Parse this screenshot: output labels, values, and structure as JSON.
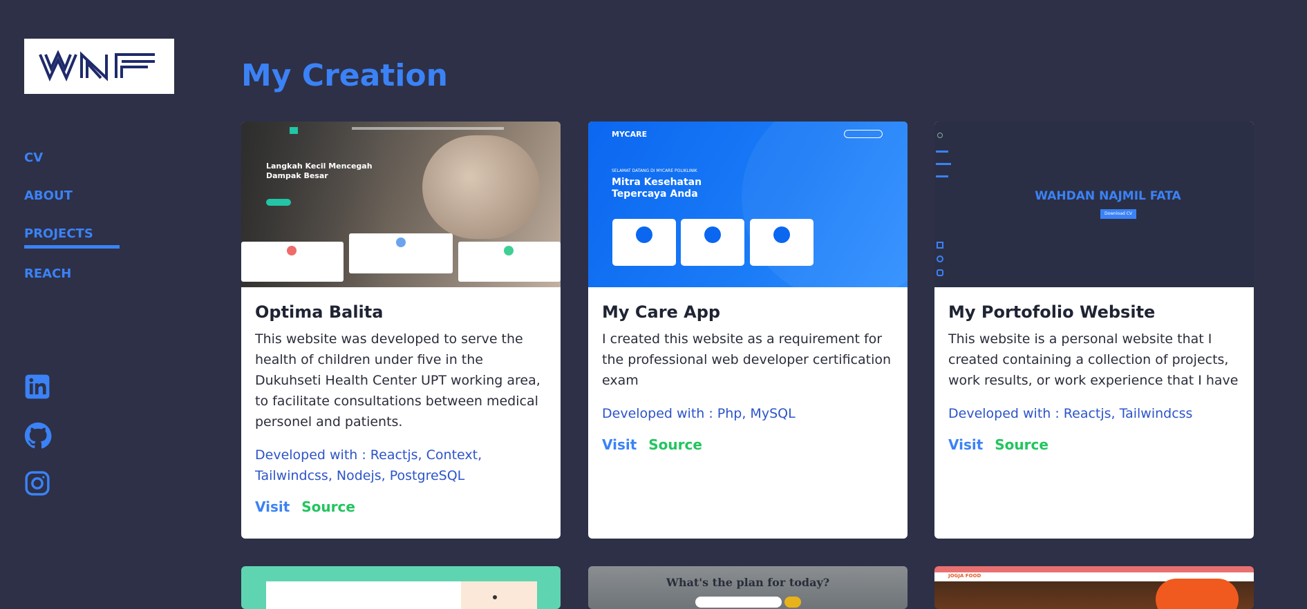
{
  "logo": {
    "text": "WNF"
  },
  "nav": {
    "items": [
      {
        "label": "CV"
      },
      {
        "label": "ABOUT"
      },
      {
        "label": "PROJECTS",
        "active": true
      },
      {
        "label": "REACH"
      }
    ]
  },
  "social": [
    {
      "icon": "linkedin-icon"
    },
    {
      "icon": "github-icon"
    },
    {
      "icon": "instagram-icon"
    }
  ],
  "page_title": "My Creation",
  "cards": [
    {
      "title": "Optima Balita",
      "description": "This website was developed to serve the health of children under five in the Dukuhseti Health Center UPT working area, to facilitate consultations between medical personel and patients.",
      "tech": "Developed with : Reactjs, Context, Tailwindcss, Nodejs, PostgreSQL",
      "visit": "Visit",
      "source": "Source",
      "thumb": {
        "headline": "Langkah Kecil Mencegah Dampak Besar"
      }
    },
    {
      "title": "My Care App",
      "description": "I created this website as a requirement for the professional web developer certification exam",
      "tech": "Developed with : Php, MySQL",
      "visit": "Visit",
      "source": "Source",
      "thumb": {
        "brand": "MYCARE",
        "kicker": "SELAMAT DATANG DI MYCARE POLIKLINIK",
        "headline_1": "Mitra Kesehatan",
        "headline_2": "Tepercaya Anda"
      }
    },
    {
      "title": "My Portofolio Website",
      "description": "This website is a personal website that I created containing a collection of projects, work results, or work experience that I have",
      "tech": "Developed with : Reactjs, Tailwindcss",
      "visit": "Visit",
      "source": "Source",
      "thumb": {
        "name": "WAHDAN NAJMIL FATA",
        "button": "Download CV"
      }
    }
  ],
  "bottom_thumbs": [
    {
      "caption": ""
    },
    {
      "caption": "What's the plan for today?"
    },
    {
      "caption": "JOGJA FOOD"
    }
  ],
  "colors": {
    "background": "#2d3047",
    "accent": "#3b82f6",
    "source": "#22c55e",
    "tech": "#2c54c9"
  }
}
